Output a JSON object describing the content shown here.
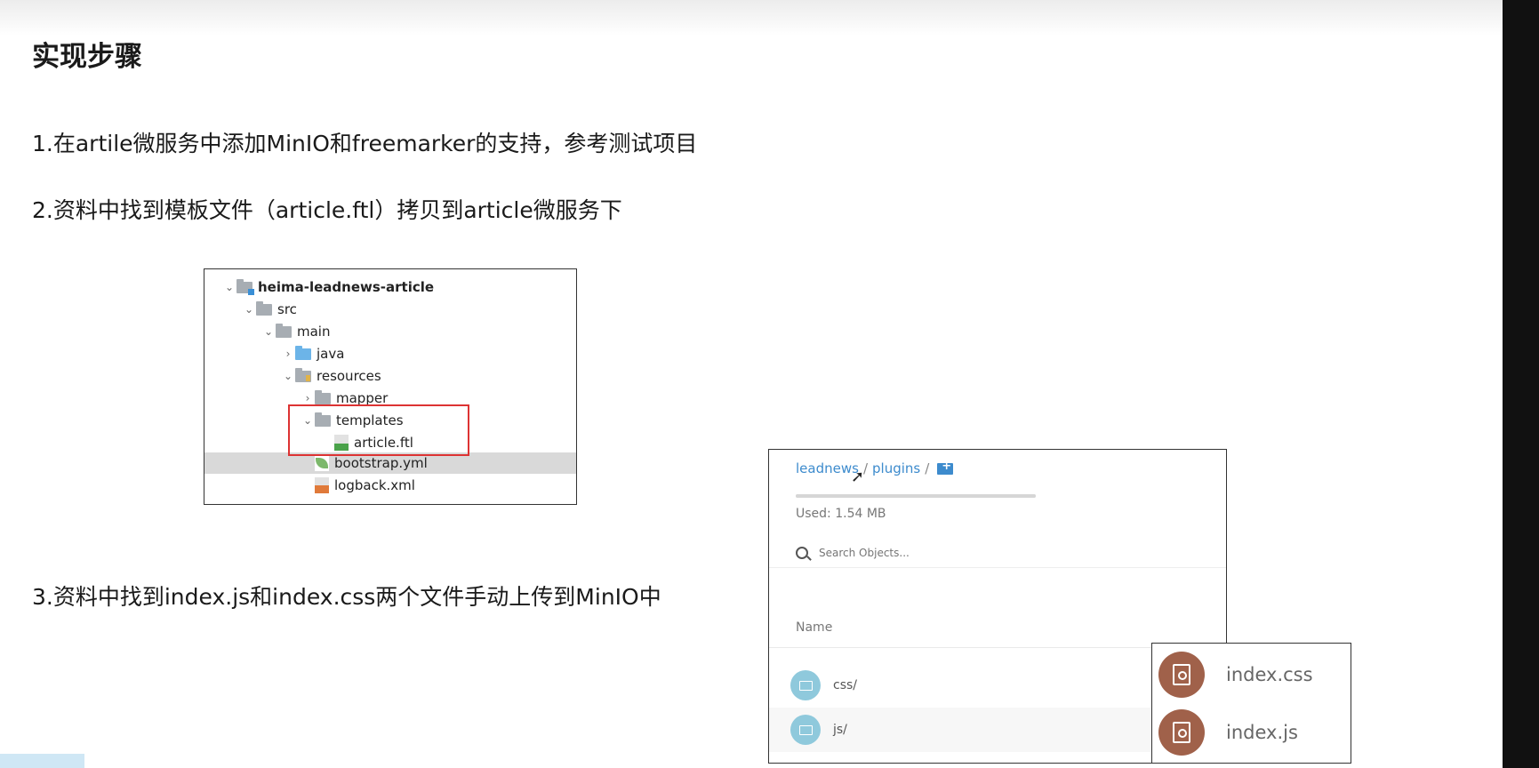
{
  "slide": {
    "title": "实现步骤",
    "steps": [
      "1.在artile微服务中添加MinIO和freemarker的支持，参考测试项目",
      "2.资料中找到模板文件（article.ftl）拷贝到article微服务下",
      "3.资料中找到index.js和index.css两个文件手动上传到MinIO中"
    ]
  },
  "project_tree": {
    "items": [
      {
        "label": "heima-leadnews-article",
        "chevron": "⌄"
      },
      {
        "label": "src",
        "chevron": "⌄"
      },
      {
        "label": "main",
        "chevron": "⌄"
      },
      {
        "label": "java",
        "chevron": "›"
      },
      {
        "label": "resources",
        "chevron": "⌄"
      },
      {
        "label": "mapper",
        "chevron": "›"
      },
      {
        "label": "templates",
        "chevron": "⌄"
      },
      {
        "label": "article.ftl",
        "chevron": ""
      },
      {
        "label": "bootstrap.yml",
        "chevron": ""
      },
      {
        "label": "logback.xml",
        "chevron": ""
      }
    ]
  },
  "minio": {
    "breadcrumb": [
      "leadnews",
      "plugins"
    ],
    "breadcrumb_sep": "/",
    "usage_fraction": 1.0,
    "used_text": "Used: 1.54 MB",
    "search_placeholder": "Search Objects...",
    "column_name": "Name",
    "objects": [
      "css/",
      "js/"
    ]
  },
  "file_popup": {
    "files": [
      "index.css",
      "index.js"
    ]
  },
  "colors": {
    "link": "#3d8bcd",
    "folder_circle": "#8fc9dc",
    "file_circle": "#a0614a",
    "highlight_box": "#dd3333"
  }
}
